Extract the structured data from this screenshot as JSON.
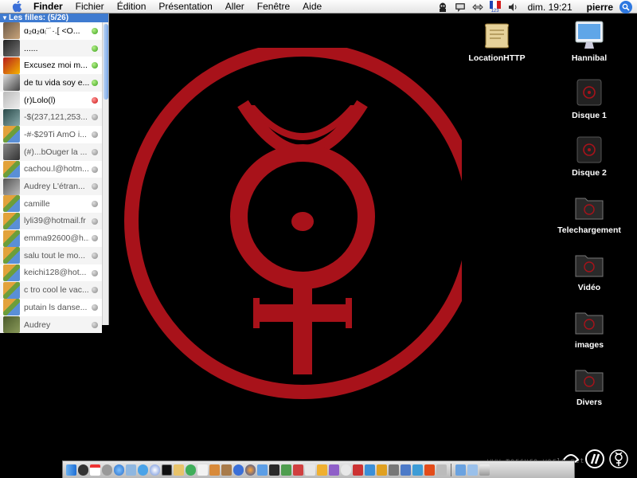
{
  "menubar": {
    "app": "Finder",
    "menus": [
      "Fichier",
      "Édition",
      "Présentation",
      "Aller",
      "Fenêtre",
      "Aide"
    ],
    "flag_caption": "123",
    "clock": "dim. 19:21",
    "user": "pierre"
  },
  "buddy_list": {
    "group_label": "Les filles: (5/26)",
    "rows": [
      {
        "name": "ɑ₂ɑ₂ɑ₍¨˙·.[ <O...",
        "status": "green"
      },
      {
        "name": "......",
        "status": "green"
      },
      {
        "name": "Excusez moi m...",
        "status": "green"
      },
      {
        "name": "de tu vida soy e...",
        "status": "green"
      },
      {
        "name": "(r)Lolo(l)",
        "status": "red"
      },
      {
        "name": "-$(237,121,253...",
        "status": "grey"
      },
      {
        "name": "-#-$29Ti AmO i...",
        "status": "grey"
      },
      {
        "name": "(#)...bOuger la ...",
        "status": "grey"
      },
      {
        "name": "cachou.l@hotm...",
        "status": "grey"
      },
      {
        "name": "Audrey  L'étran...",
        "status": "grey"
      },
      {
        "name": "camille",
        "status": "grey"
      },
      {
        "name": "lyli39@hotmail.fr",
        "status": "grey"
      },
      {
        "name": "emma92600@h...",
        "status": "grey"
      },
      {
        "name": "salu tout le mo...",
        "status": "grey"
      },
      {
        "name": "keichi128@hot...",
        "status": "grey"
      },
      {
        "name": "c tro cool le vac...",
        "status": "grey"
      },
      {
        "name": "putain ls danse...",
        "status": "grey"
      },
      {
        "name": "Audrey",
        "status": "grey"
      }
    ]
  },
  "desktop_icons": [
    {
      "label": "LocationHTTP",
      "icon": "scroll-document-icon"
    },
    {
      "label": "Hannibal",
      "icon": "imac-computer-icon"
    },
    {
      "label": "Disque 1",
      "icon": "hard-disk-icon"
    },
    {
      "label": "Disque 2",
      "icon": "hard-disk-icon"
    },
    {
      "label": "Telechargement",
      "icon": "folder-icon"
    },
    {
      "label": "Vidéo",
      "icon": "folder-icon"
    },
    {
      "label": "images",
      "icon": "folder-icon"
    },
    {
      "label": "Divers",
      "icon": "folder-icon"
    }
  ],
  "watermark": "www.mercure-world.net",
  "colors": {
    "symbol_red": "#a8121a",
    "menubar_bg": "#eeeeee",
    "buddy_group_bg": "#3f7bd0",
    "desktop_bg": "#000000"
  }
}
